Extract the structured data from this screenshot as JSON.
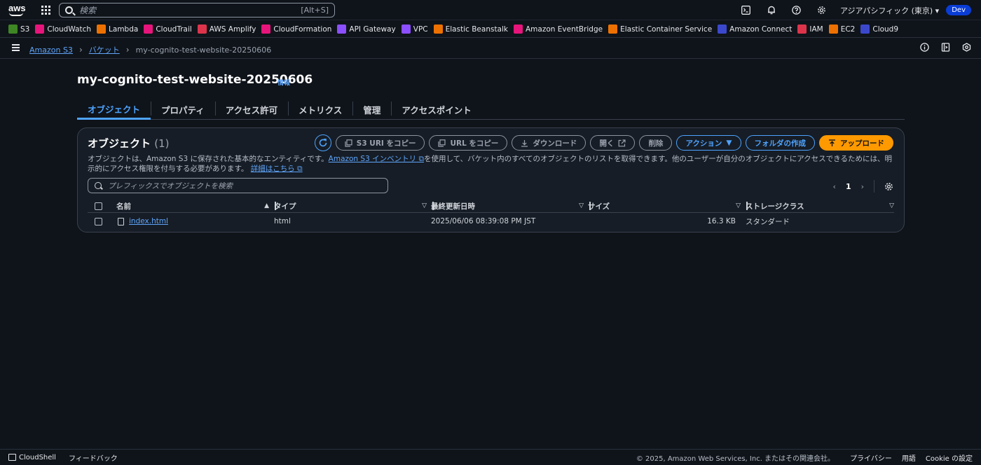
{
  "topnav": {
    "logo": "aws",
    "search_placeholder": "検索",
    "search_shortcut": "[Alt+S]",
    "region": "アジアパシフィック (東京)",
    "account": "Dev"
  },
  "favorites": [
    {
      "label": "S3",
      "icon": "s3-icon",
      "color": "#3f8624"
    },
    {
      "label": "CloudWatch",
      "icon": "cloudwatch-icon",
      "color": "#e7157b"
    },
    {
      "label": "Lambda",
      "icon": "lambda-icon",
      "color": "#ed7100"
    },
    {
      "label": "CloudTrail",
      "icon": "cloudtrail-icon",
      "color": "#e7157b"
    },
    {
      "label": "AWS Amplify",
      "icon": "amplify-icon",
      "color": "#dd344c"
    },
    {
      "label": "CloudFormation",
      "icon": "cloudformation-icon",
      "color": "#e7157b"
    },
    {
      "label": "API Gateway",
      "icon": "api-gateway-icon",
      "color": "#8c4fff"
    },
    {
      "label": "VPC",
      "icon": "vpc-icon",
      "color": "#8c4fff"
    },
    {
      "label": "Elastic Beanstalk",
      "icon": "beanstalk-icon",
      "color": "#ed7100"
    },
    {
      "label": "Amazon EventBridge",
      "icon": "eventbridge-icon",
      "color": "#e7157b"
    },
    {
      "label": "Elastic Container Service",
      "icon": "ecs-icon",
      "color": "#ed7100"
    },
    {
      "label": "Amazon Connect",
      "icon": "connect-icon",
      "color": "#3b48cc"
    },
    {
      "label": "IAM",
      "icon": "iam-icon",
      "color": "#dd344c"
    },
    {
      "label": "EC2",
      "icon": "ec2-icon",
      "color": "#ed7100"
    },
    {
      "label": "Cloud9",
      "icon": "cloud9-icon",
      "color": "#3b48cc"
    }
  ],
  "breadcrumb": {
    "items": [
      "Amazon S3",
      "バケット"
    ],
    "current": "my-cognito-test-website-20250606"
  },
  "page": {
    "title": "my-cognito-test-website-20250606",
    "info": "情報"
  },
  "tabs": [
    {
      "label": "オブジェクト",
      "active": true
    },
    {
      "label": "プロパティ",
      "active": false
    },
    {
      "label": "アクセス許可",
      "active": false
    },
    {
      "label": "メトリクス",
      "active": false
    },
    {
      "label": "管理",
      "active": false
    },
    {
      "label": "アクセスポイント",
      "active": false
    }
  ],
  "objects": {
    "heading": "オブジェクト",
    "count": "(1)",
    "buttons": {
      "copy_s3_uri": "S3 URI をコピー",
      "copy_url": "URL をコピー",
      "download": "ダウンロード",
      "open": "開く",
      "delete": "削除",
      "actions": "アクション",
      "create_folder": "フォルダの作成",
      "upload": "アップロード"
    },
    "description_1": "オブジェクトは、Amazon S3 に保存された基本的なエンティティです。",
    "description_link": "Amazon S3 インベントリ",
    "description_2": "を使用して、バケット内のすべてのオブジェクトのリストを取得できます。他のユーザーが自分のオブジェクトにアクセスできるためには、明示的にアクセス権限を付与する必要があります。",
    "learn_more": "詳細はこちら",
    "filter_placeholder": "プレフィックスでオブジェクトを検索",
    "page_number": "1",
    "columns": {
      "name": "名前",
      "type": "タイプ",
      "last_modified": "最終更新日時",
      "size": "サイズ",
      "storage_class": "ストレージクラス"
    },
    "rows": [
      {
        "name": "index.html",
        "type": "html",
        "last_modified": "2025/06/06 08:39:08 PM JST",
        "size": "16.3 KB",
        "storage_class": "スタンダード"
      }
    ]
  },
  "footer": {
    "cloudshell": "CloudShell",
    "feedback": "フィードバック",
    "copyright": "© 2025, Amazon Web Services, Inc. またはその関連会社。",
    "privacy": "プライバシー",
    "terms": "用語",
    "cookie": "Cookie の設定"
  }
}
